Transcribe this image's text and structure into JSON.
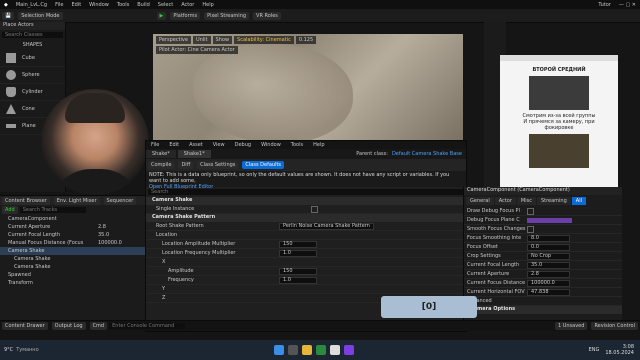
{
  "app": {
    "tab_title": "Main_LvL.Cg",
    "menu": [
      "File",
      "Edit",
      "Window",
      "Tools",
      "Build",
      "Select",
      "Actor",
      "Help"
    ],
    "right_user": "Tutor"
  },
  "toolbar": {
    "selection_mode": "Selection Mode",
    "platforms": "Platforms",
    "pixel_streaming": "Pixel Streaming",
    "vr_roles": "VR Roles"
  },
  "place_actors": {
    "title": "Place Actors",
    "search_placeholder": "Search Classes",
    "category": "SHAPES",
    "items": [
      "Cube",
      "Sphere",
      "Cylinder",
      "Cone",
      "Plane"
    ]
  },
  "viewport": {
    "perspective": "Perspective",
    "unlit": "Unlit",
    "show": "Show",
    "scalability": "Scalability: Cinematic",
    "pilot_label": "Pilot Actor: Cine Camera Actor",
    "fps": "0.125"
  },
  "blueprint": {
    "menu": [
      "File",
      "Edit",
      "Asset",
      "View",
      "Debug",
      "Window",
      "Tools",
      "Help"
    ],
    "tabs": [
      "Shake*",
      "Shake1*"
    ],
    "tools": [
      "Compile",
      "Diff",
      "Class Settings",
      "Class Defaults"
    ],
    "parent_label": "Parent class:",
    "parent_value": "Default Camera Shake Base",
    "note": "NOTE: This is a data only blueprint, so only the default values are shown.  It does not have any script or variables.  If you want to add some,",
    "note_link": "Open Full Blueprint Editor",
    "search_placeholder": "Search",
    "sections": {
      "camera_shake": "Camera Shake",
      "camera_shake_pattern": "Camera Shake Pattern",
      "location": "Location"
    },
    "props": {
      "single_instance": "Single Instance",
      "root_pattern": "Root Shake Pattern",
      "root_pattern_value": "Perlin Noise Camera Shake Pattern",
      "loc_amp": "Location Amplitude Multiplier",
      "loc_amp_value": "150",
      "loc_freq": "Location Frequency Multiplier",
      "loc_freq_value": "1.0",
      "x": "X",
      "amplitude": "Amplitude",
      "amplitude_value": "150",
      "frequency": "Frequency",
      "frequency_value": "1.0",
      "y": "Y",
      "z": "Z"
    }
  },
  "content_browser": {
    "tab": "Content Browser",
    "tab2": "Env. Light Mixer",
    "tab3": "Sequencer",
    "add": "Add",
    "search_placeholder": "Search Tracks",
    "tree": [
      "CameraComponent",
      "Current Aperture",
      "Current Focal Length",
      "Manual Focus Distance (Focus",
      "Camera Shake",
      "Camera Shake",
      "Camera Shake",
      "Spawned",
      "Transform"
    ],
    "values": [
      "2.8",
      "35.0",
      "100000.0"
    ]
  },
  "details": {
    "component": "CameraComponent (CameraComponent)",
    "tabs": [
      "General",
      "Actor",
      "Misc",
      "Streaming",
      "All"
    ],
    "props": [
      {
        "k": "Draw Debug Focus Pl",
        "v": ""
      },
      {
        "k": "Debug Focus Plane C",
        "v": ""
      },
      {
        "k": "Smooth Focus Changes",
        "v": ""
      },
      {
        "k": "Focus Smoothing Inte",
        "v": "8.0"
      },
      {
        "k": "Focus Offset",
        "v": "0.0"
      },
      {
        "k": "Crop Settings",
        "v": "No Crop"
      },
      {
        "k": "Current Focal Length",
        "v": "35.0"
      },
      {
        "k": "Current Aperture",
        "v": "2.8"
      },
      {
        "k": "Current Focus Distance",
        "v": "100000.0"
      },
      {
        "k": "Current Horizontal FOV",
        "v": "47.838"
      },
      {
        "k": "Advanced",
        "v": ""
      },
      {
        "k": "Camera Options",
        "v": ""
      }
    ]
  },
  "website": {
    "heading": "ВТОРОЙ СРЕДНИЙ",
    "caption1": "Смотрим из-за всей группы",
    "caption2": "И прячемся за камеру, при фокировке"
  },
  "status_bar": {
    "content_drawer": "Content Drawer",
    "output_log": "Output Log",
    "cmd": "Cmd",
    "console": "Enter Console Command",
    "unsaved": "1 Unsaved",
    "revision": "Revision Control"
  },
  "toast": "[0]",
  "taskbar": {
    "weather": "9°C",
    "weather2": "Туманно",
    "lang": "ENG",
    "time": "3:08",
    "date": "18.05.2024"
  }
}
